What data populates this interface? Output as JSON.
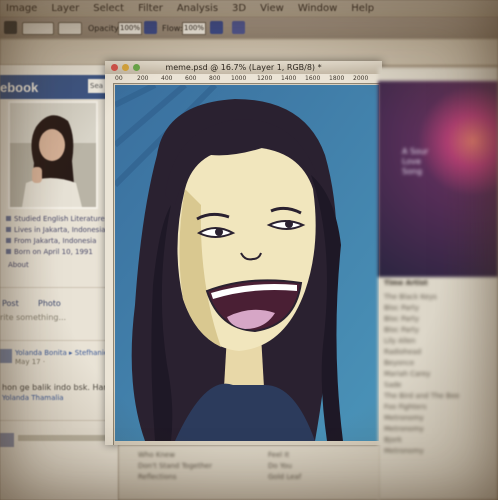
{
  "menubar": {
    "items": [
      "Image",
      "Layer",
      "Select",
      "Filter",
      "Analysis",
      "3D",
      "View",
      "Window",
      "Help"
    ]
  },
  "options": {
    "opacity_label": "Opacity:",
    "opacity_value": "100%",
    "flow_label": "Flow:",
    "flow_value": "100%"
  },
  "facebook": {
    "logo": "ebook",
    "search_placeholder": "Sea",
    "info": [
      "Studied English Literature at Bin",
      "Lives in Jakarta, Indonesia",
      "From Jakarta, Indonesia",
      "Born on April 10, 1991"
    ],
    "about": "About",
    "post_label": "Post",
    "photo_label": "Photo",
    "composer_placeholder": "rite something...",
    "feed_author": "Yolanda Bonita",
    "feed_arrow": "▸",
    "feed_target": "Stefhanie",
    "feed_meta": "May 17 ·",
    "feed_text": "hon ge balik indo bsk. Hari",
    "feed_author2": "Yolanda Thamalia"
  },
  "document": {
    "title": "meme.psd @ 16.7% (Layer 1, RGB/8) *",
    "ruler_ticks": [
      "00",
      "200",
      "400",
      "600",
      "800",
      "1000",
      "1200",
      "1400",
      "1600",
      "1800",
      "2000"
    ]
  },
  "colors": {
    "canvas_bg": "#3d7aa6",
    "hair": "#2a2130",
    "skin": "#f1e6bd",
    "mouth": "#4a1f34",
    "tongue": "#d6a6c6",
    "facebook_blue": "#3c5586"
  },
  "right_panel": {
    "art_text": "A Sour\nLove\nSong",
    "header": "Time   Artist",
    "rows": [
      "The Black Keys",
      "Bloc Party",
      "Bloc Party",
      "Bloc Party",
      "Lily Allen",
      "Radiohead",
      "Beyonce",
      "Mariah Carey",
      "Sade",
      "The Bird and The Bee",
      "Foo Fighters",
      "Metronomy",
      "Metronomy",
      "Bjork",
      "Metronomy"
    ]
  },
  "bottom": {
    "left_items": [
      "Who Knew",
      "Don't Stand Together",
      "Reflections"
    ],
    "right_items": [
      "Feel It",
      "Do You",
      "Gold Leaf"
    ]
  }
}
